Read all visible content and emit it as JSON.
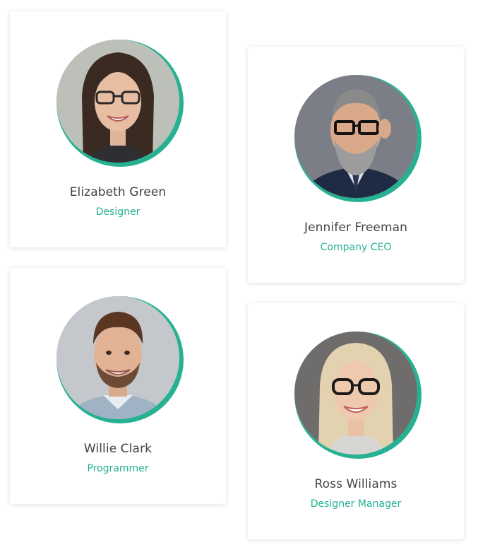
{
  "accent_color": "#26b192",
  "members": [
    {
      "name": "Elizabeth Green",
      "role": "Designer",
      "photo": "woman-dark-hair-glasses-portrait"
    },
    {
      "name": "Jennifer Freeman",
      "role": "Company CEO",
      "photo": "bearded-man-glasses-portrait"
    },
    {
      "name": "Willie Clark",
      "role": "Programmer",
      "photo": "smiling-young-man-portrait"
    },
    {
      "name": "Ross Williams",
      "role": "Designer Manager",
      "photo": "blonde-woman-glasses-portrait"
    }
  ]
}
